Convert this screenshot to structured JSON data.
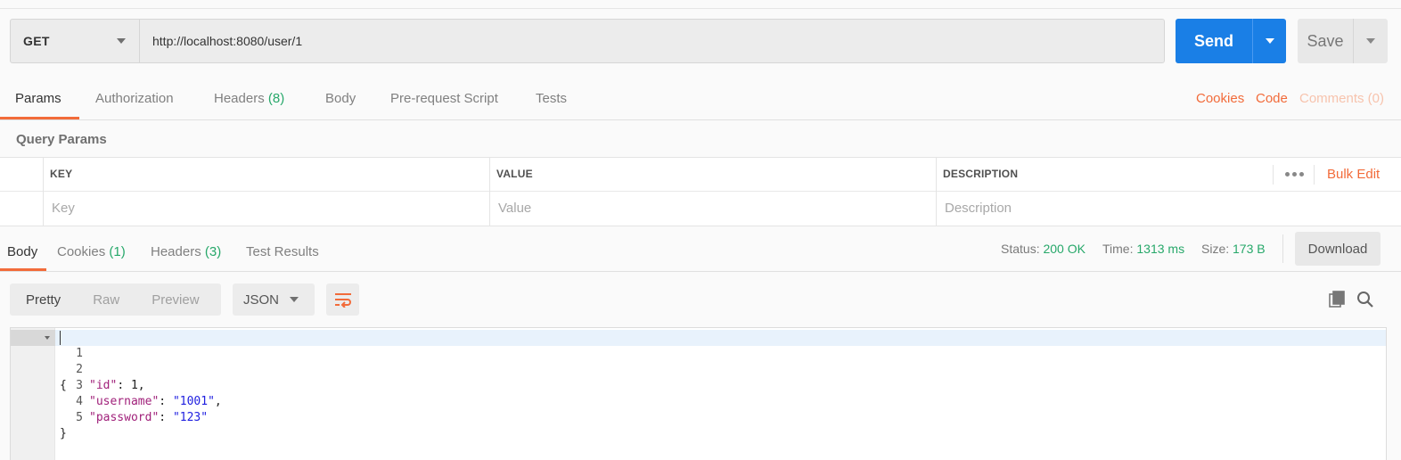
{
  "request": {
    "method": "GET",
    "url": "http://localhost:8080/user/1",
    "send_label": "Send",
    "save_label": "Save"
  },
  "request_tabs": [
    {
      "label": "Params",
      "count": ""
    },
    {
      "label": "Authorization",
      "count": ""
    },
    {
      "label": "Headers",
      "count": "(8)"
    },
    {
      "label": "Body",
      "count": ""
    },
    {
      "label": "Pre-request Script",
      "count": ""
    },
    {
      "label": "Tests",
      "count": ""
    }
  ],
  "right_links": {
    "cookies": "Cookies",
    "code": "Code",
    "comments": "Comments (0)"
  },
  "query_params": {
    "title": "Query Params",
    "headers": {
      "key": "KEY",
      "value": "VALUE",
      "description": "DESCRIPTION"
    },
    "placeholders": {
      "key": "Key",
      "value": "Value",
      "description": "Description"
    },
    "bulk_edit": "Bulk Edit"
  },
  "response_tabs": [
    {
      "label": "Body",
      "count": ""
    },
    {
      "label": "Cookies",
      "count": "(1)"
    },
    {
      "label": "Headers",
      "count": "(3)"
    },
    {
      "label": "Test Results",
      "count": ""
    }
  ],
  "response_status": {
    "status_label": "Status:",
    "status_value": "200 OK",
    "time_label": "Time:",
    "time_value": "1313 ms",
    "size_label": "Size:",
    "size_value": "173 B",
    "download_label": "Download"
  },
  "view": {
    "modes": [
      "Pretty",
      "Raw",
      "Preview"
    ],
    "active_mode": "Pretty",
    "format": "JSON"
  },
  "editor": {
    "lines": [
      {
        "num": "1",
        "open": "{"
      },
      {
        "num": "2",
        "key": "\"id\"",
        "colon": ": ",
        "value": "1",
        "tail": ","
      },
      {
        "num": "3",
        "key": "\"username\"",
        "colon": ": ",
        "value": "\"1001\"",
        "tail": ","
      },
      {
        "num": "4",
        "key": "\"password\"",
        "colon": ": ",
        "value": "\"123\"",
        "tail": ""
      },
      {
        "num": "5",
        "open": "}"
      }
    ]
  },
  "colors": {
    "accent": "#f26b3a",
    "send_blue": "#1a7fe6",
    "success_green": "#27a86a"
  },
  "icons": [
    "chevron-down-icon",
    "wrap-lines-icon",
    "copy-icon",
    "search-icon",
    "more-dots-icon"
  ]
}
